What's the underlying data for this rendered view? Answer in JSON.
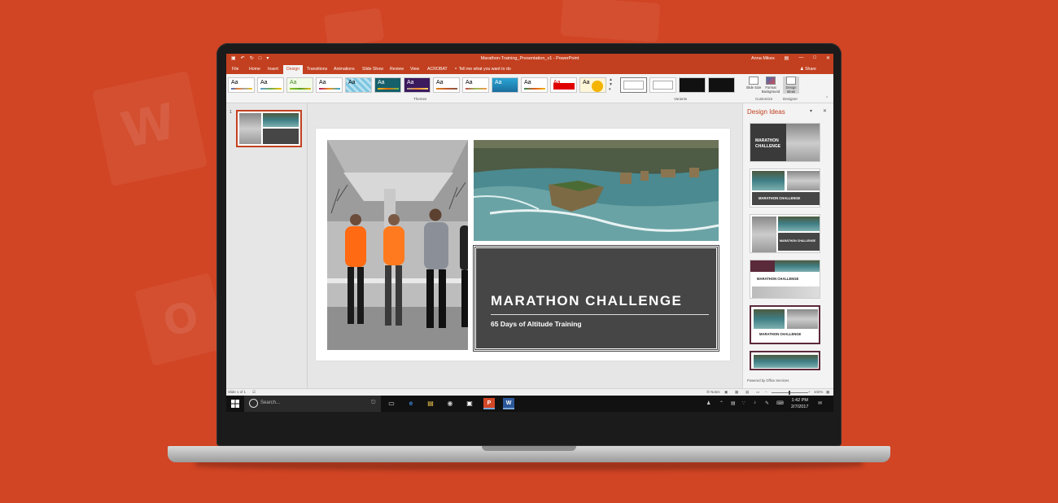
{
  "window": {
    "title": "Marathon-Training_Presentation_v1 - PowerPoint",
    "user": "Anna Mikes",
    "share": "Share"
  },
  "tabs": [
    "File",
    "Home",
    "Insert",
    "Design",
    "Transitions",
    "Animations",
    "Slide Show",
    "Review",
    "View",
    "ACROBAT"
  ],
  "active_tab": "Design",
  "tell_me": "Tell me what you want to do",
  "ribbon": {
    "themes_label": "Themes",
    "variants_label": "Variants",
    "customize_label": "Customize",
    "designer_label": "Designer",
    "theme_sample": "Aa",
    "slide_size": "Slide Size",
    "format_background": "Format Background",
    "design_ideas_btn": "Design Ideas"
  },
  "thumbnails": {
    "slide_number": "1"
  },
  "slide": {
    "title": "MARATHON CHALLENGE",
    "subtitle": "65 Days of Altitude Training"
  },
  "design_ideas": {
    "title": "Design Ideas",
    "idea_title": "MARATHON CHALLENGE",
    "idea_title_split_1": "MARATHON",
    "idea_title_split_2": "CHALLENGE",
    "powered_by": "Powered by Office Services"
  },
  "status": {
    "slide_of": "Slide 1 of 1",
    "notes": "Notes",
    "zoom": "102%"
  },
  "taskbar": {
    "search": "Search...",
    "time": "1:42 PM",
    "date": "2/7/2017"
  },
  "colors": {
    "background": "#d14424",
    "accent": "#c2401f",
    "title_box": "#464646"
  }
}
